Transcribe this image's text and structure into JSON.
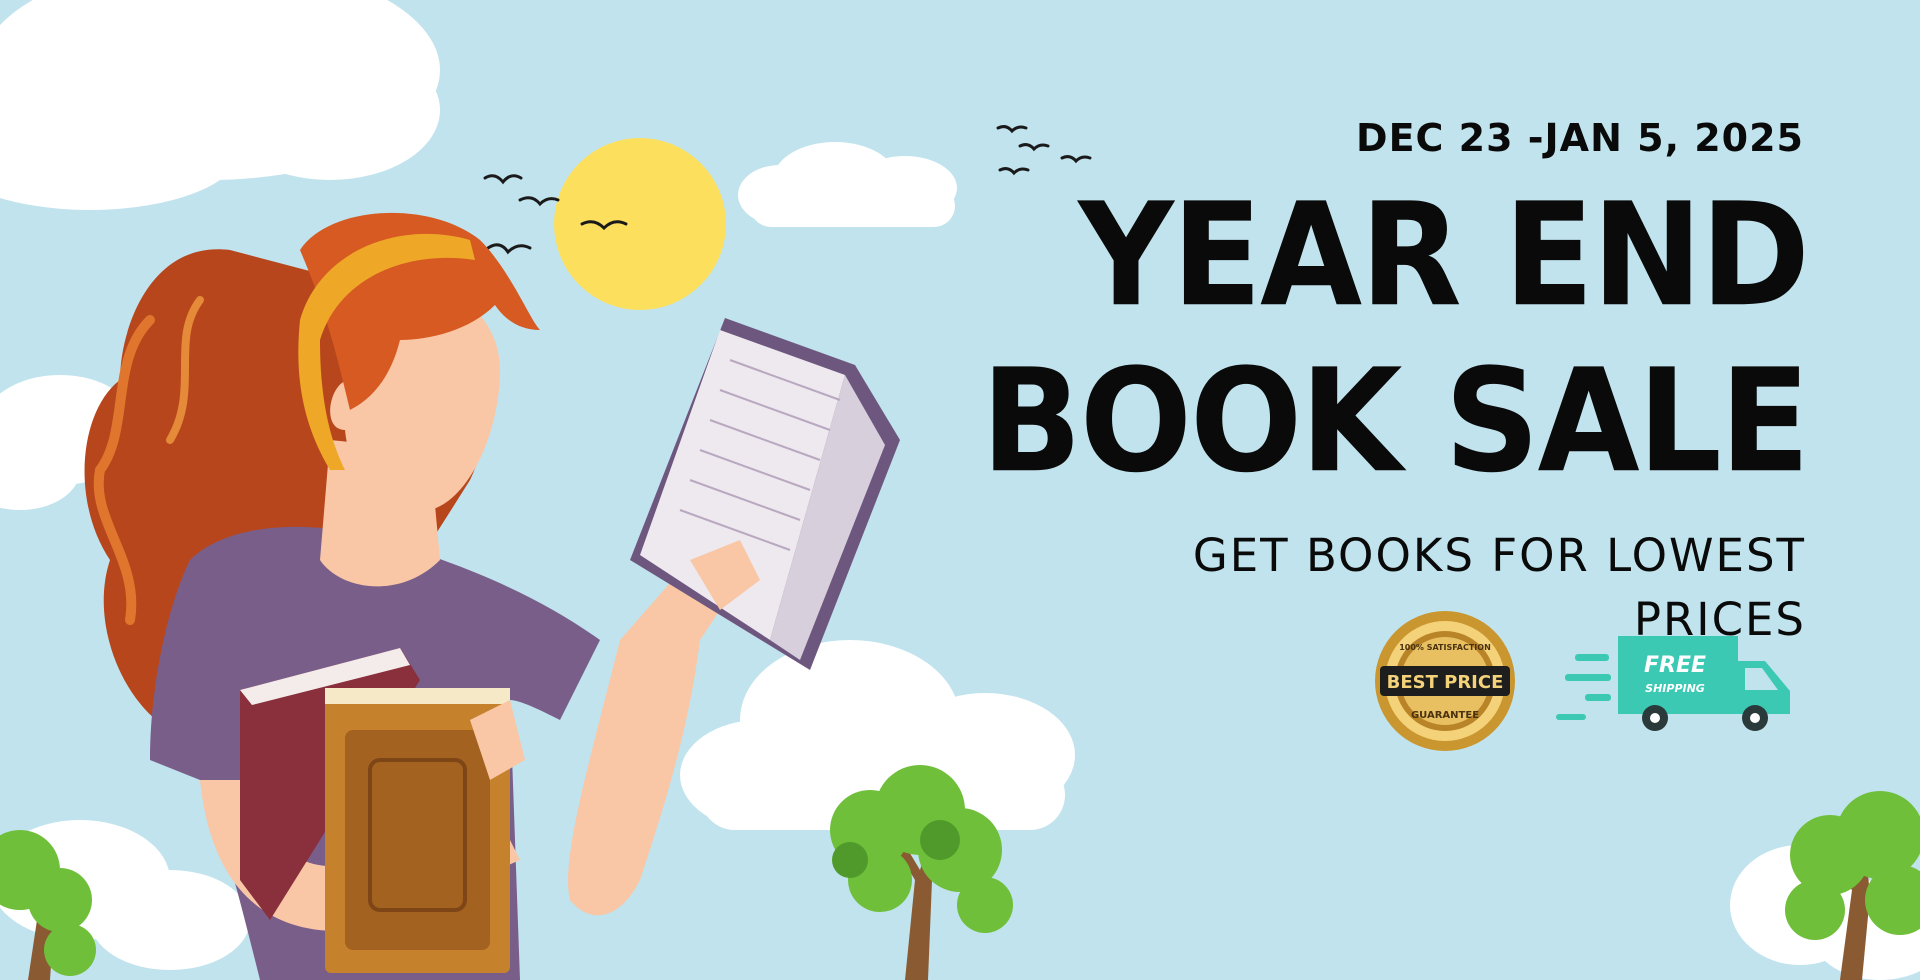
{
  "promo": {
    "date_range": "DEC 23 -JAN 5, 2025",
    "headline_line1": "YEAR END",
    "headline_line2": "BOOK SALE",
    "tagline_line1": "GET BOOKS FOR LOWEST",
    "tagline_line2": "PRICES"
  },
  "badges": {
    "seal_top": "100% SATISFACTION",
    "seal_main": "BEST PRICE",
    "seal_bottom": "GUARANTEE",
    "truck_line1": "FREE",
    "truck_line2": "SHIPPING"
  },
  "colors": {
    "sky": "#c0e3ee",
    "sun": "#fddf5e",
    "hair": "#c9521f",
    "shirt": "#7a5e8a",
    "skin": "#f9c7a6",
    "tree_green": "#6fbf3a",
    "truck": "#3cc9b4",
    "gold": "#d6aa3e"
  }
}
